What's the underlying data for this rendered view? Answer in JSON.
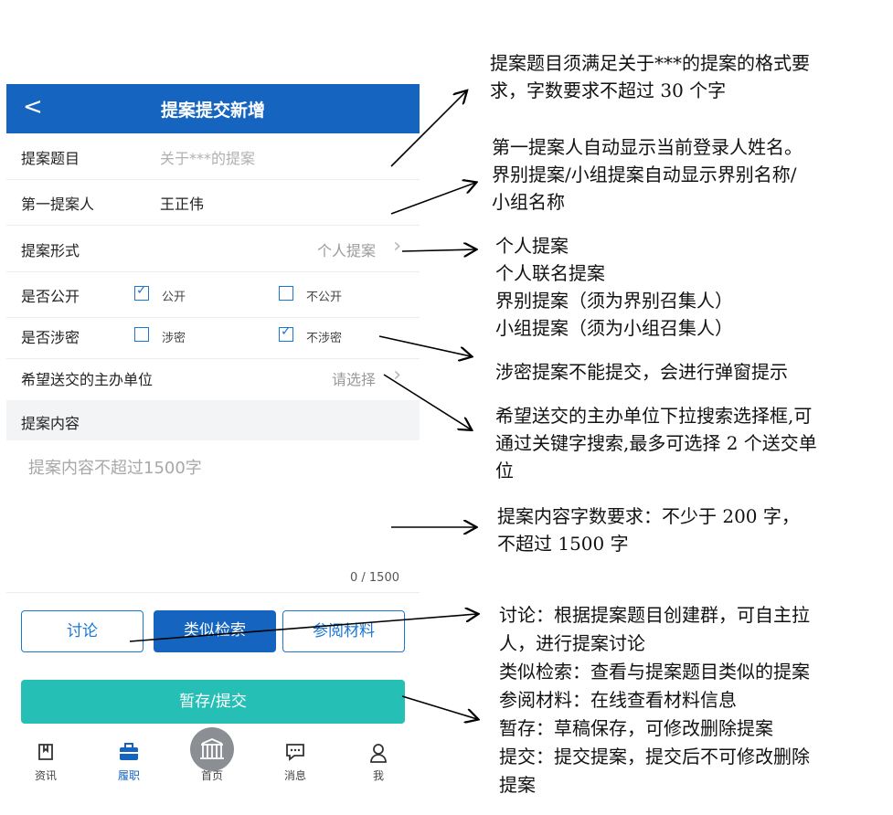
{
  "header": {
    "back_icon": "chevron-left-icon",
    "back_glyph": "<",
    "title": "提案提交新增"
  },
  "form": {
    "subject_label": "提案题目",
    "subject_placeholder": "关于***的提案",
    "proposer_label": "第一提案人",
    "proposer_value": "王正伟",
    "form_label": "提案形式",
    "form_value": "个人提案",
    "public_label": "是否公开",
    "public_options": [
      {
        "label": "公开",
        "checked": true
      },
      {
        "label": "不公开",
        "checked": false
      }
    ],
    "secret_label": "是否涉密",
    "secret_options": [
      {
        "label": "涉密",
        "checked": false
      },
      {
        "label": "不涉密",
        "checked": true
      }
    ],
    "unit_label": "希望送交的主办单位",
    "unit_value": "请选择",
    "content_section": "提案内容",
    "content_placeholder": "提案内容不超过1500字",
    "counter": "0 / 1500"
  },
  "actions": {
    "discuss": "讨论",
    "similar": "类似检索",
    "reference": "参阅材料",
    "submit": "暂存/提交"
  },
  "tabs": [
    {
      "label": "资讯",
      "icon": "book-icon",
      "active": false
    },
    {
      "label": "履职",
      "icon": "briefcase-icon",
      "active": true
    },
    {
      "label": "首页",
      "icon": "building-icon",
      "active": false
    },
    {
      "label": "消息",
      "icon": "chat-icon",
      "active": false
    },
    {
      "label": "我",
      "icon": "person-icon",
      "active": false
    }
  ],
  "annotations": {
    "subject": [
      "提案题目须满足关于***的提案的格式要",
      "求，字数要求不超过 30 个字"
    ],
    "proposer": [
      "第一提案人自动显示当前登录人姓名。",
      "界别提案/小组提案自动显示界别名称/",
      "小组名称"
    ],
    "form_types": [
      "个人提案",
      "个人联名提案",
      "界别提案（须为界别召集人）",
      "小组提案（须为小组召集人）"
    ],
    "secret": [
      "涉密提案不能提交，会进行弹窗提示"
    ],
    "unit": [
      "希望送交的主办单位下拉搜索选择框,可",
      "通过关键字搜索,最多可选择 2 个送交单",
      "位"
    ],
    "content": [
      "提案内容字数要求：不少于 200 字，",
      "不超过 1500 字"
    ],
    "actions": [
      "讨论：根据提案题目创建群，可自主拉",
      "人，进行提案讨论",
      "类似检索：查看与提案题目类似的提案",
      "参阅材料：在线查看材料信息",
      "暂存：草稿保存，可修改删除提案",
      "提交：提交提案，提交后不可修改删除",
      "提案"
    ]
  },
  "colors": {
    "primary": "#1565c0",
    "submit": "#26bfb5",
    "checkbox": "#1976d2"
  }
}
